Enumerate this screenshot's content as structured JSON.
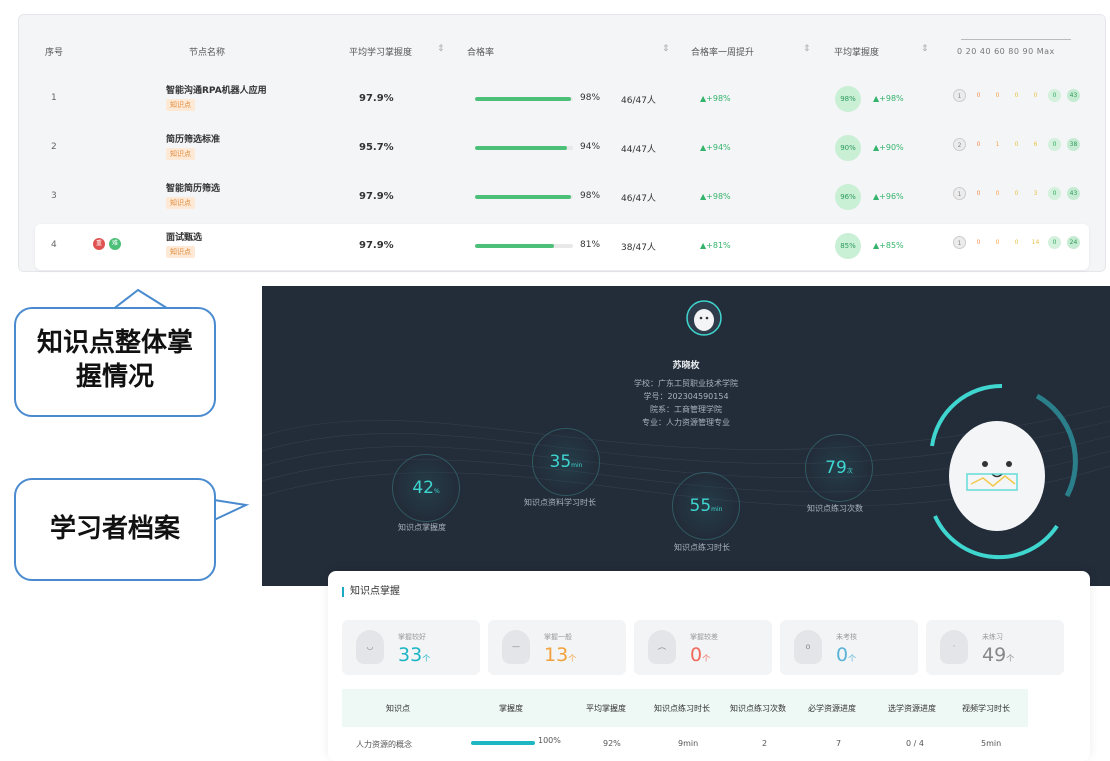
{
  "table": {
    "headers": {
      "index": "序号",
      "node_name": "节点名称",
      "avg_mastery": "平均学习掌握度",
      "pass_rate": "合格率",
      "pass_rate_week": "合格率一周提升",
      "avg_proficiency": "平均掌握度",
      "scale": "0  20  40  60  80  90 Max"
    },
    "sort_icon": "⇕",
    "rows": [
      {
        "index": "1",
        "name": "智能沟通RPA机器人应用",
        "tag": "知识点",
        "avg": "97.9%",
        "bar": 0.98,
        "pct": "98%",
        "frac": "46/47人",
        "lift": "▲+98%",
        "circle": "98%",
        "lift2": "▲+98%",
        "dist": [
          "1",
          "0",
          "0",
          "0",
          "0",
          "0",
          "43"
        ]
      },
      {
        "index": "2",
        "name": "简历筛选标准",
        "tag": "知识点",
        "avg": "95.7%",
        "bar": 0.94,
        "pct": "94%",
        "frac": "44/47人",
        "lift": "▲+94%",
        "circle": "90%",
        "lift2": "▲+90%",
        "dist": [
          "2",
          "0",
          "1",
          "0",
          "6",
          "0",
          "38"
        ]
      },
      {
        "index": "3",
        "name": "智能简历筛选",
        "tag": "知识点",
        "avg": "97.9%",
        "bar": 0.98,
        "pct": "98%",
        "frac": "46/47人",
        "lift": "▲+98%",
        "circle": "96%",
        "lift2": "▲+96%",
        "dist": [
          "1",
          "0",
          "0",
          "0",
          "3",
          "0",
          "43"
        ]
      },
      {
        "index": "4",
        "name": "面试甄选",
        "tag": "知识点",
        "avg": "97.9%",
        "bar": 0.81,
        "pct": "81%",
        "frac": "38/47人",
        "lift": "▲+81%",
        "circle": "85%",
        "lift2": "▲+85%",
        "dist": [
          "1",
          "0",
          "0",
          "0",
          "14",
          "0",
          "24"
        ],
        "badges": [
          "重",
          "难"
        ]
      }
    ]
  },
  "callouts": {
    "overall_line1": "知识点整体掌",
    "overall_line2": "握情况",
    "profile": "学习者档案"
  },
  "profile": {
    "name": "苏晓枚",
    "school": "学校：广东工贸职业技术学院",
    "student_id": "学号：202304590154",
    "department": "院系：工商管理学院",
    "major": "专业：人力资源管理专业",
    "stats": [
      {
        "value": "42",
        "unit": "%",
        "label": "知识点掌握度"
      },
      {
        "value": "35",
        "unit": "min",
        "label": "知识点资料学习时长"
      },
      {
        "value": "55",
        "unit": "min",
        "label": "知识点练习时长"
      },
      {
        "value": "79",
        "unit": "次",
        "label": "知识点练习次数"
      }
    ]
  },
  "mastery": {
    "title": "知识点掌握",
    "cards": [
      {
        "label": "掌握较好",
        "value": "33",
        "unit": "个",
        "color": "#1bb5c5",
        "face": "◡"
      },
      {
        "label": "掌握一般",
        "value": "13",
        "unit": "个",
        "color": "#f2a23a",
        "face": "—"
      },
      {
        "label": "掌握较差",
        "value": "0",
        "unit": "个",
        "color": "#ef6a5a",
        "face": "︵"
      },
      {
        "label": "未考核",
        "value": "0",
        "unit": "个",
        "color": "#5ab4d8",
        "face": "o"
      },
      {
        "label": "未练习",
        "value": "49",
        "unit": "个",
        "color": "#888888",
        "face": "·"
      }
    ],
    "columns": [
      "知识点",
      "掌握度",
      "平均掌握度",
      "知识点练习时长",
      "知识点练习次数",
      "必学资源进度",
      "选学资源进度",
      "视频学习时长"
    ],
    "row": {
      "name": "人力资源的概念",
      "mastery": "100%",
      "avg": "92%",
      "practice_time": "9min",
      "practice_count": "2",
      "required": "7",
      "elective": "0 / 4",
      "video": "5min"
    }
  }
}
